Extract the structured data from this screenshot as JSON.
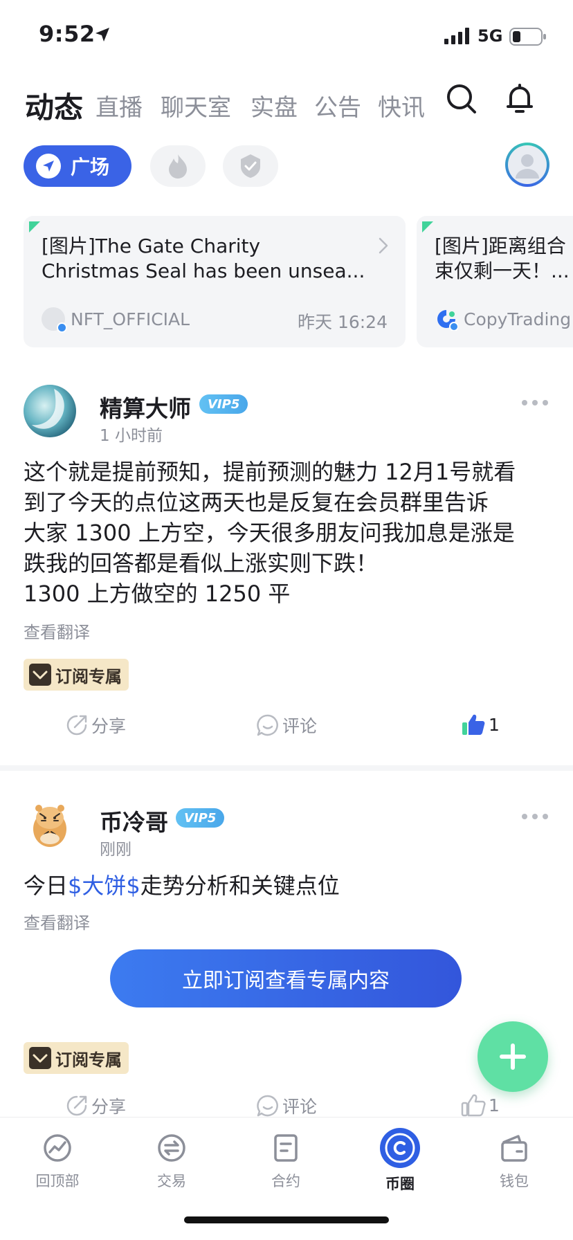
{
  "status_bar": {
    "time": "9:52",
    "network": "5G"
  },
  "top_nav": {
    "tabs": [
      {
        "label": "动态",
        "active": true
      },
      {
        "label": "直播",
        "active": false
      },
      {
        "label": "聊天室",
        "active": false
      },
      {
        "label": "实盘",
        "active": false
      },
      {
        "label": "公告",
        "active": false
      },
      {
        "label": "快讯",
        "active": false
      }
    ]
  },
  "filters": {
    "main_label": "广场"
  },
  "announcements": [
    {
      "title_line1": "[图片]The Gate Charity",
      "title_line2": "Christmas Seal has been unsea...",
      "author": "NFT_OFFICIAL",
      "time": "昨天 16:24"
    },
    {
      "title_line1": "[图片]距离组合",
      "title_line2": "束仅剩一天！...",
      "author": "CopyTrading",
      "time": ""
    }
  ],
  "posts": [
    {
      "author": "精算大师",
      "vip": "VIP5",
      "time": "1 小时前",
      "body_lines": [
        "这个就是提前预知，提前预测的魅力 12月1号就看",
        "到了今天的点位这两天也是反复在会员群里告诉",
        "大家 1300 上方空，今天很多朋友问我加息是涨是",
        "跌我的回答都是看似上涨实则下跌！",
        "1300 上方做空的 1250 平"
      ],
      "translate": "查看翻译",
      "tag": "订阅专属",
      "share": "分享",
      "comment": "评论",
      "likes": "1"
    },
    {
      "author": "币冷哥",
      "vip": "VIP5",
      "time": "刚刚",
      "body_prefix": "今日",
      "body_token": "$大饼$",
      "body_suffix": "走势分析和关键点位",
      "translate": "查看翻译",
      "subscribe_button": "立即订阅查看专属内容",
      "tag": "订阅专属",
      "share": "分享",
      "comment": "评论",
      "likes": "1"
    }
  ],
  "tab_bar": {
    "items": [
      {
        "label": "回顶部",
        "icon": "chart-up-icon",
        "active": false
      },
      {
        "label": "交易",
        "icon": "exchange-icon",
        "active": false
      },
      {
        "label": "合约",
        "icon": "contract-icon",
        "active": false
      },
      {
        "label": "币圈",
        "icon": "coin-circle-icon",
        "active": true
      },
      {
        "label": "钱包",
        "icon": "wallet-icon",
        "active": false
      }
    ]
  },
  "colors": {
    "accent_blue": "#3a63e6",
    "fab_green": "#5fe0a4",
    "vip_blue": "#49a7ea",
    "tag_gold": "#f5e7c7"
  }
}
